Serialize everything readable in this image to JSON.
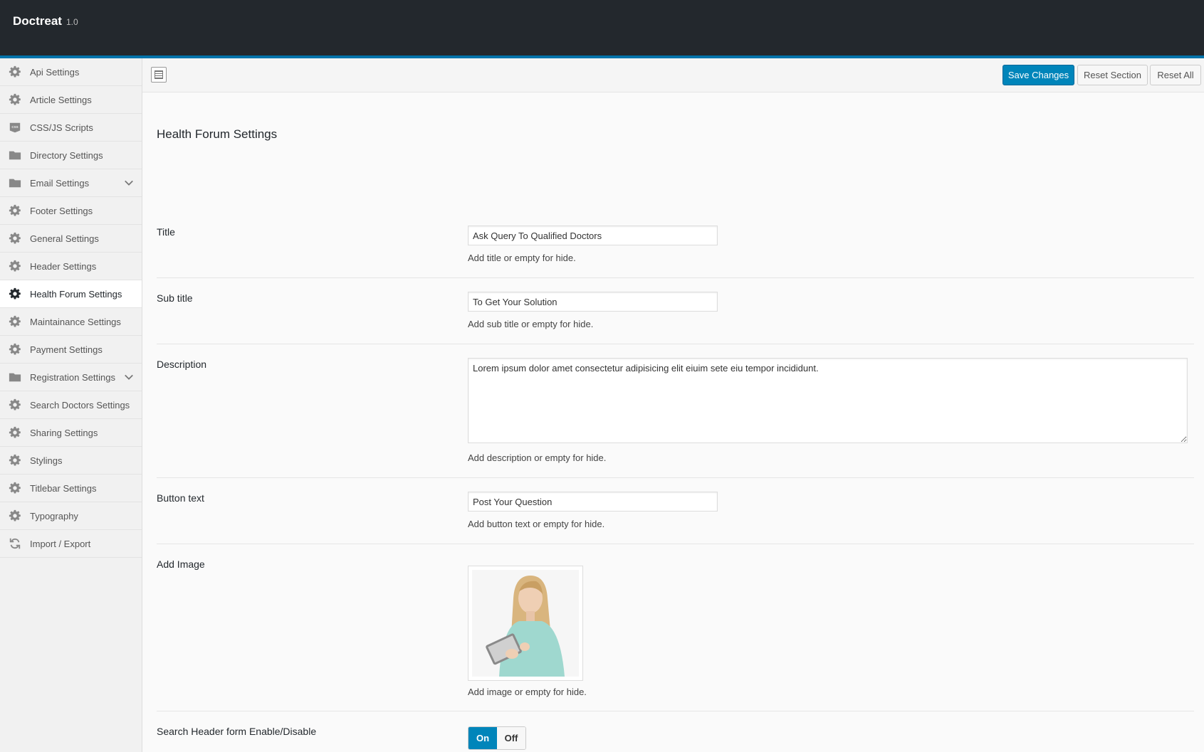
{
  "header": {
    "brand": "Doctreat",
    "version": "1.0"
  },
  "sidebar": {
    "items": [
      {
        "label": "Api Settings",
        "icon": "gear-icon"
      },
      {
        "label": "Article Settings",
        "icon": "gear-icon"
      },
      {
        "label": "CSS/JS Scripts",
        "icon": "css-icon"
      },
      {
        "label": "Directory Settings",
        "icon": "folder-icon"
      },
      {
        "label": "Email Settings",
        "icon": "folder-icon"
      },
      {
        "label": "Footer Settings",
        "icon": "gear-icon"
      },
      {
        "label": "General Settings",
        "icon": "gear-icon"
      },
      {
        "label": "Header Settings",
        "icon": "gear-icon"
      },
      {
        "label": "Health Forum Settings",
        "icon": "gear-icon"
      },
      {
        "label": "Maintainance Settings",
        "icon": "gear-icon"
      },
      {
        "label": "Payment Settings",
        "icon": "gear-icon"
      },
      {
        "label": "Registration Settings",
        "icon": "folder-icon"
      },
      {
        "label": "Search Doctors Settings",
        "icon": "gear-icon"
      },
      {
        "label": "Sharing Settings",
        "icon": "gear-icon"
      },
      {
        "label": "Stylings",
        "icon": "gear-icon"
      },
      {
        "label": "Titlebar Settings",
        "icon": "gear-icon"
      },
      {
        "label": "Typography",
        "icon": "gear-icon"
      },
      {
        "label": "Import / Export",
        "icon": "refresh-icon"
      }
    ],
    "active": "Health Forum Settings"
  },
  "toolbar": {
    "save_label": "Save Changes",
    "reset_section_label": "Reset Section",
    "reset_all_label": "Reset All"
  },
  "section": {
    "title": "Health Forum Settings"
  },
  "fields": {
    "title": {
      "label": "Title",
      "value": "Ask Query To Qualified Doctors",
      "help": "Add title or empty for hide."
    },
    "subtitle": {
      "label": "Sub title",
      "value": "To Get Your Solution",
      "help": "Add sub title or empty for hide."
    },
    "description": {
      "label": "Description",
      "value": "Lorem ipsum dolor amet consectetur adipisicing elit eiuim sete eiu tempor incididunt.",
      "help": "Add description or empty for hide."
    },
    "button_text": {
      "label": "Button text",
      "value": "Post Your Question",
      "help": "Add button text or empty for hide."
    },
    "image": {
      "label": "Add Image",
      "help": "Add image or empty for hide."
    },
    "search_header": {
      "label": "Search Header form Enable/Disable",
      "on_label": "On",
      "off_label": "Off",
      "value": "On"
    }
  },
  "colors": {
    "accent": "#0085ba",
    "topbar": "#23282d"
  }
}
